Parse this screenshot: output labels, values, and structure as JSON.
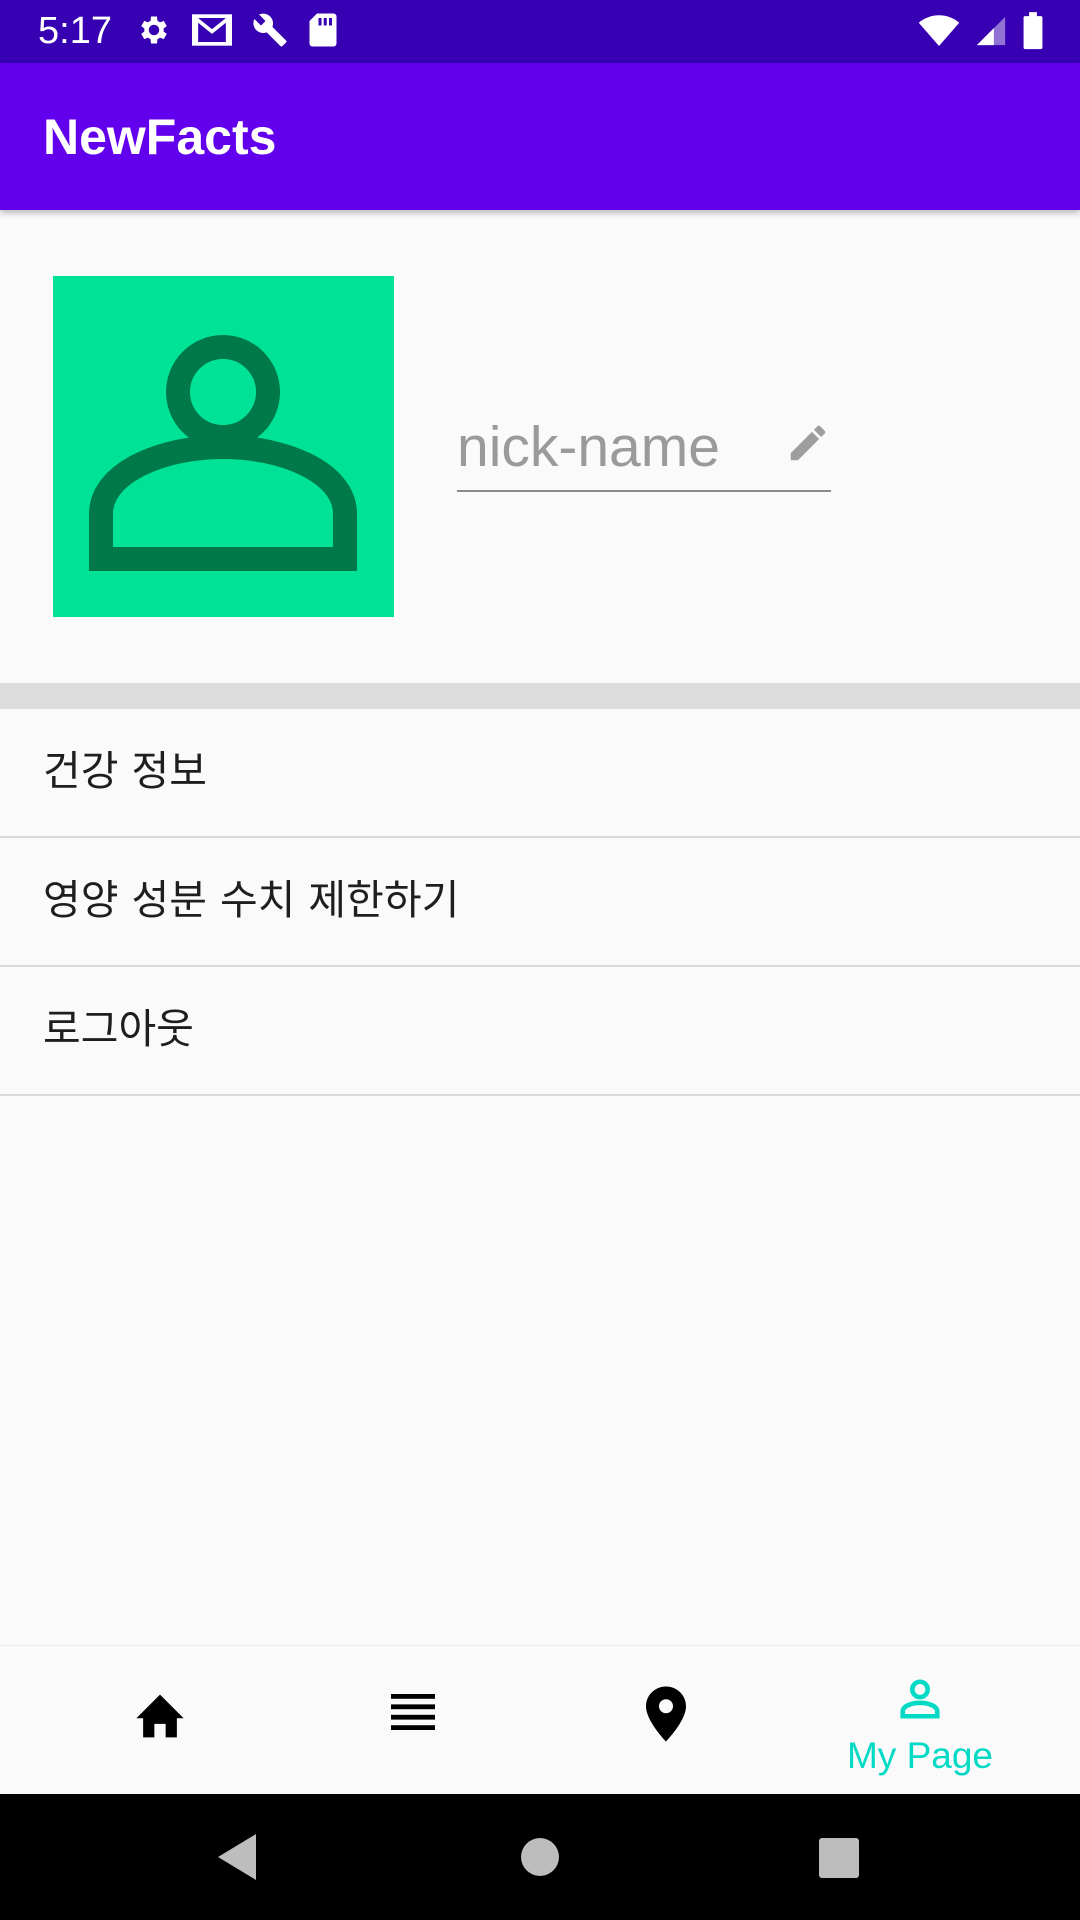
{
  "status_bar": {
    "time": "5:17",
    "left_icons": [
      "settings-icon",
      "gmail-icon",
      "wrench-icon",
      "sd-card-icon"
    ],
    "right_icons": [
      "wifi-icon",
      "cellular-signal-icon",
      "battery-icon"
    ]
  },
  "app_bar": {
    "title": "NewFacts"
  },
  "profile": {
    "avatar_icon": "person-icon",
    "avatar_color": "#00e396",
    "nickname_placeholder": "nick-name",
    "nickname_value": "",
    "edit_icon": "pencil-icon"
  },
  "menu": {
    "items": [
      {
        "label": "건강 정보"
      },
      {
        "label": "영양 성분 수치 제한하기"
      },
      {
        "label": "로그아웃"
      }
    ]
  },
  "bottom_nav": {
    "items": [
      {
        "icon": "home-icon",
        "label": "",
        "selected": false
      },
      {
        "icon": "list-icon",
        "label": "",
        "selected": false
      },
      {
        "icon": "map-pin-icon",
        "label": "",
        "selected": false
      },
      {
        "icon": "person-outline-icon",
        "label": "My Page",
        "selected": true
      }
    ],
    "selected_color": "#03dac5"
  },
  "system_nav": {
    "buttons": [
      "back-icon",
      "home-circle-icon",
      "recents-icon"
    ]
  },
  "colors": {
    "status_bar": "#3700b3",
    "app_bar": "#6200ee",
    "accent": "#03dac5"
  }
}
